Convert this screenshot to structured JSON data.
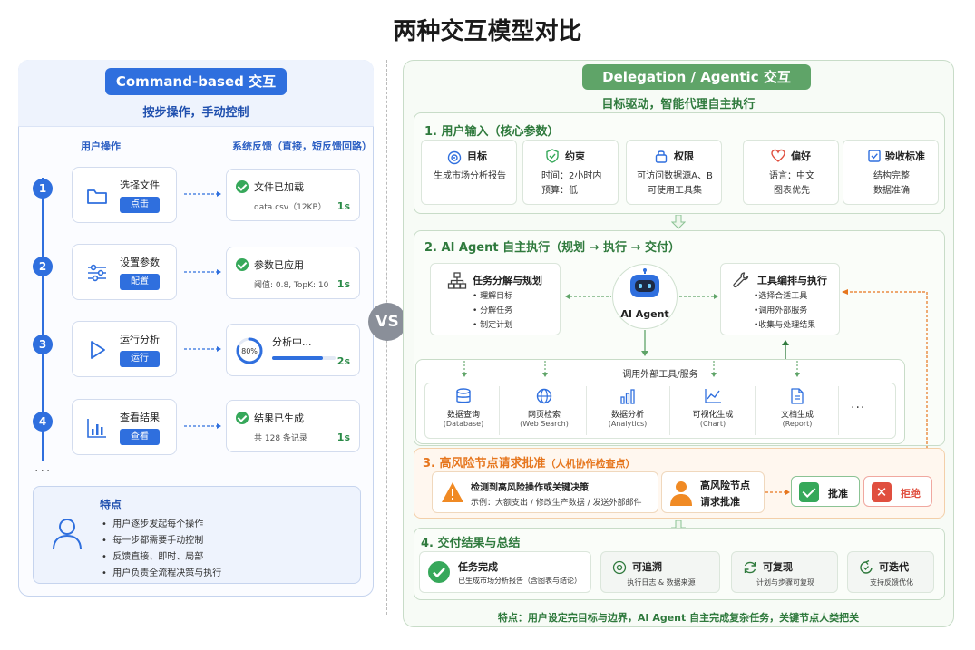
{
  "title": "两种交互模型对比",
  "left": {
    "badge": "Command-based 交互",
    "subtitle": "按步操作，手动控制",
    "col_user": "用户操作",
    "col_feedback": "系统反馈（直接，短反馈回路）",
    "steps": [
      {
        "num": "1",
        "title": "选择文件",
        "button": "点击",
        "icon": "folder-icon",
        "fb_title": "文件已加载",
        "fb_detail": "data.csv（12KB）",
        "fb_time": "1s"
      },
      {
        "num": "2",
        "title": "设置参数",
        "button": "配置",
        "icon": "sliders-icon",
        "fb_title": "参数已应用",
        "fb_detail": "阈值: 0.8, TopK: 10",
        "fb_time": "1s"
      },
      {
        "num": "3",
        "title": "运行分析",
        "button": "运行",
        "icon": "play-icon",
        "fb_title": "分析中...",
        "fb_detail": "80%",
        "fb_time": "2s",
        "progress": 0.8
      },
      {
        "num": "4",
        "title": "查看结果",
        "button": "查看",
        "icon": "bar-chart-icon",
        "fb_title": "结果已生成",
        "fb_detail": "共 128 条记录",
        "fb_time": "1s"
      }
    ],
    "ellipsis": "...",
    "features_title": "特点",
    "features": [
      "用户逐步发起每个操作",
      "每一步都需要手动控制",
      "反馈直接、即时、局部",
      "用户负责全流程决策与执行"
    ]
  },
  "vs": "VS",
  "right": {
    "badge": "Delegation / Agentic 交互",
    "subtitle": "目标驱动，智能代理自主执行",
    "sec1_title": "1. 用户输入（核心参数）",
    "inputs": [
      {
        "title": "目标",
        "icon": "target-icon",
        "lines": [
          "生成市场分析报告"
        ]
      },
      {
        "title": "约束",
        "icon": "shield-icon",
        "lines": [
          "时间：2小时内",
          "预算：低"
        ]
      },
      {
        "title": "权限",
        "icon": "lock-icon",
        "lines": [
          "可访问数据源A、B",
          "可使用工具集"
        ]
      },
      {
        "title": "偏好",
        "icon": "heart-icon",
        "lines": [
          "语言：中文",
          "图表优先"
        ]
      },
      {
        "title": "验收标准",
        "icon": "checkbox-icon",
        "lines": [
          "结构完整",
          "数据准确"
        ]
      }
    ],
    "sec2_title": "2. AI Agent 自主执行（规划 → 执行 → 交付）",
    "plan_title": "任务分解与规划",
    "plan_items": [
      "• 理解目标",
      "• 分解任务",
      "• 制定计划"
    ],
    "agent_label": "AI Agent",
    "exec_title": "工具编排与执行",
    "exec_items": [
      "•选择合适工具",
      "•调用外部服务",
      "•收集与处理结果"
    ],
    "tools_label": "调用外部工具/服务",
    "tools": [
      {
        "name": "数据查询",
        "sub": "(Database)",
        "icon": "database-icon"
      },
      {
        "name": "网页检索",
        "sub": "(Web Search)",
        "icon": "globe-icon"
      },
      {
        "name": "数据分析",
        "sub": "(Analytics)",
        "icon": "analytics-icon"
      },
      {
        "name": "可视化生成",
        "sub": "(Chart)",
        "icon": "line-chart-icon"
      },
      {
        "name": "文档生成",
        "sub": "(Report)",
        "icon": "document-icon"
      }
    ],
    "tools_more": "···",
    "sec3_title": "3. 高风险节点请求批准",
    "sec3_paren": "（人机协作检查点）",
    "risk_title": "检测到高风险操作或关键决策",
    "risk_example": "示例：大额支出 / 修改生产数据 / 发送外部邮件",
    "risk_req_line1": "高风险节点",
    "risk_req_line2": "请求批准",
    "approve": "批准",
    "reject": "拒绝",
    "sec4_title": "4. 交付结果与总结",
    "deliver_main_title": "任务完成",
    "deliver_main_sub": "已生成市场分析报告（含图表与结论）",
    "deliver": [
      {
        "title": "可追溯",
        "sub": "执行日志 & 数据来源",
        "icon": "trace-icon"
      },
      {
        "title": "可复现",
        "sub": "计划与步骤可复现",
        "icon": "refresh-icon"
      },
      {
        "title": "可迭代",
        "sub": "支持反馈优化",
        "icon": "iterate-icon"
      }
    ],
    "footer": "特点：用户设定完目标与边界，AI Agent 自主完成复杂任务，关键节点人类把关"
  },
  "colors": {
    "blue": "#2f6fde",
    "green": "#5fa468",
    "orange": "#e6761e",
    "check": "#36a85a",
    "red": "#e04f3f"
  }
}
